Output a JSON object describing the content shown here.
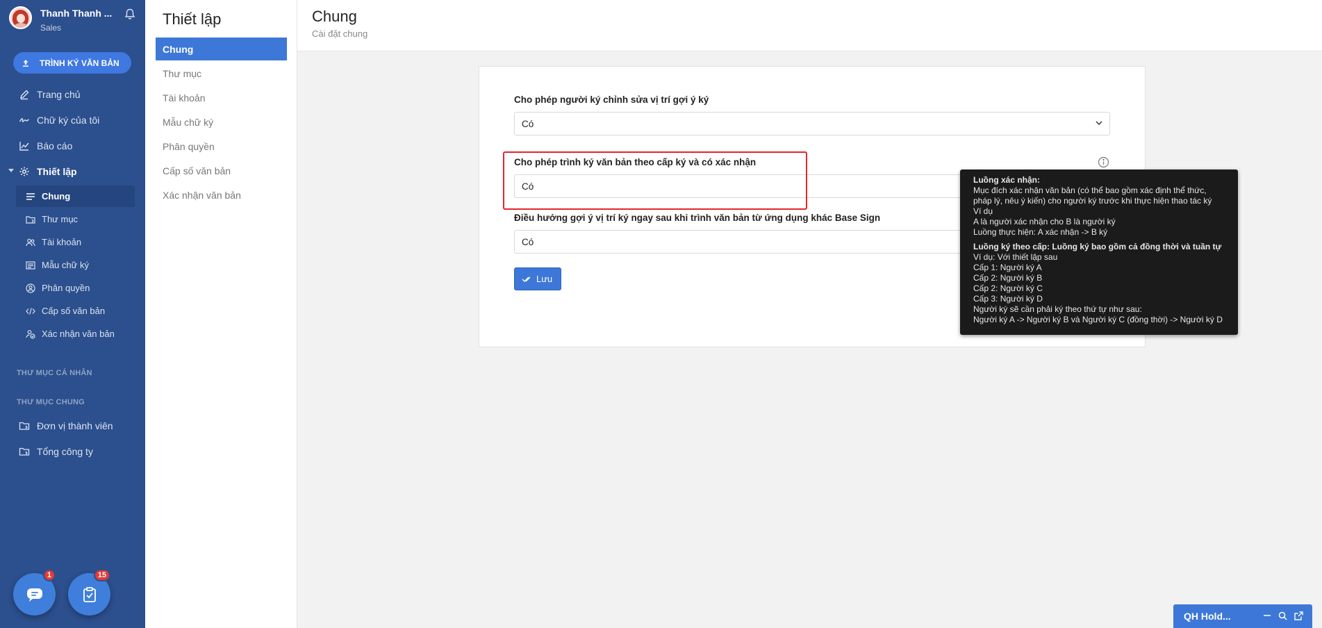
{
  "user": {
    "name": "Thanh Thanh ...",
    "role": "Sales"
  },
  "sidebar": {
    "submit_label": "TRÌNH KÝ VĂN BẢN",
    "items": [
      {
        "label": "Trang chủ",
        "icon": "pen-icon"
      },
      {
        "label": "Chữ ký của tôi",
        "icon": "signature-icon"
      },
      {
        "label": "Báo cáo",
        "icon": "chart-icon"
      },
      {
        "label": "Thiết lập",
        "icon": "gear-icon"
      }
    ],
    "sub_items": [
      {
        "label": "Chung",
        "icon": "lines-icon"
      },
      {
        "label": "Thư mục",
        "icon": "folder-icon"
      },
      {
        "label": "Tài khoản",
        "icon": "users-icon"
      },
      {
        "label": "Mẫu chữ ký",
        "icon": "template-icon"
      },
      {
        "label": "Phân quyền",
        "icon": "user-circle-icon"
      },
      {
        "label": "Cấp số văn bản",
        "icon": "code-icon"
      },
      {
        "label": "Xác nhận văn bản",
        "icon": "user-check-icon"
      }
    ],
    "personal_folders_label": "THƯ MỤC CÁ NHÂN",
    "shared_folders_label": "THƯ MỤC CHUNG",
    "shared_folders": [
      {
        "label": "Đơn vị thành viên",
        "icon": "folder-share-icon"
      },
      {
        "label": "Tổng công ty",
        "icon": "folder-share-icon"
      }
    ],
    "chat_badge": "1",
    "tasks_badge": "15"
  },
  "settings_menu": {
    "title": "Thiết lập",
    "items": [
      "Chung",
      "Thư mục",
      "Tài khoản",
      "Mẫu chữ ký",
      "Phân quyền",
      "Cấp số văn bản",
      "Xác nhận văn bản"
    ]
  },
  "header": {
    "title": "Chung",
    "subtitle": "Cài đặt chung"
  },
  "form": {
    "fields": [
      {
        "label": "Cho phép người ký chỉnh sửa vị trí gợi ý ký",
        "value": "Có"
      },
      {
        "label": "Cho phép trình ký văn bản theo cấp ký và có xác nhận",
        "value": "Có"
      },
      {
        "label": "Điều hướng gợi ý vị trí ký ngay sau khi trình văn bản từ ứng dụng khác Base Sign",
        "value": "Có"
      }
    ],
    "save_label": "Lưu"
  },
  "tooltip": {
    "lines": [
      {
        "text": "Luồng xác nhận:",
        "strong": true
      },
      {
        "text": "Mục đích xác nhận văn bản (có thể bao gồm xác định thể thức,",
        "strong": false
      },
      {
        "text": "pháp lý, nêu ý kiến) cho người ký trước khi thực hiện thao tác ký",
        "strong": false
      },
      {
        "text": "Ví dụ",
        "strong": false
      },
      {
        "text": "A là người xác nhận cho B là người ký",
        "strong": false
      },
      {
        "text": "Luồng thực hiện: A xác nhận -> B ký",
        "strong": false
      },
      {
        "text": "Luồng ký theo cấp: Luồng ký bao gồm cả đồng thời và tuần tự",
        "strong": true
      },
      {
        "text": "Ví dụ: Với thiết lập sau",
        "strong": false
      },
      {
        "text": "Cấp 1: Người ký A",
        "strong": false
      },
      {
        "text": "Cấp 2: Người ký B",
        "strong": false
      },
      {
        "text": "Cấp 2: Người ký C",
        "strong": false
      },
      {
        "text": "Cấp 3: Người ký D",
        "strong": false
      },
      {
        "text": "Người ký sẽ cần phải ký theo thứ tự như sau:",
        "strong": false
      },
      {
        "text": "Người ký A -> Người ký B và Người ký C (đồng thời) -> Người ký D",
        "strong": false
      }
    ]
  },
  "chat_widget": {
    "label": "QH Hold..."
  },
  "colors": {
    "sidebar": "#2c4f8d",
    "accent": "#3d78d8",
    "highlight": "#e6242a",
    "tooltip_bg": "#1b1b1b"
  }
}
